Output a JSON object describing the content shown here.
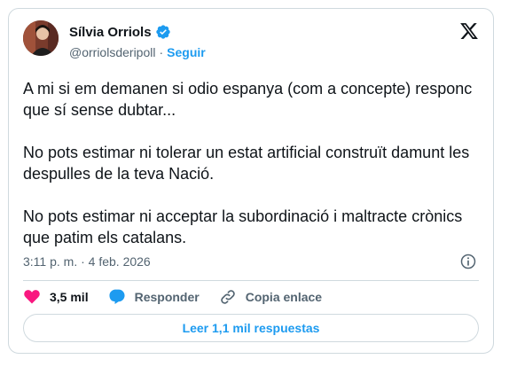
{
  "author": {
    "name": "Sílvia Orriols",
    "handle": "@orriolsderipoll",
    "separator": "·",
    "follow_label": "Seguir"
  },
  "tweet": {
    "paragraphs": [
      "A mi si em demanen si odio espanya (com a concepte) responc que sí sense dubtar...",
      "No pots estimar ni tolerar un estat artificial construït damunt les despulles de la teva Nació.",
      "No pots estimar ni acceptar la subordinació i maltracte crònics que patim els catalans."
    ],
    "timestamp": "3:11 p. m. · 4 feb. 2026"
  },
  "actions": {
    "likes": "3,5 mil",
    "reply_label": "Responder",
    "copy_link_label": "Copia enlace"
  },
  "read_replies_label": "Leer 1,1 mil respuestas",
  "colors": {
    "accent": "#1d9bf0",
    "like": "#f91880",
    "text": "#0f1419",
    "secondary": "#536471",
    "border": "#cfd9de"
  },
  "icons": [
    "verified-badge-icon",
    "x-logo-icon",
    "info-icon",
    "heart-icon",
    "reply-bubble-icon",
    "link-icon"
  ]
}
